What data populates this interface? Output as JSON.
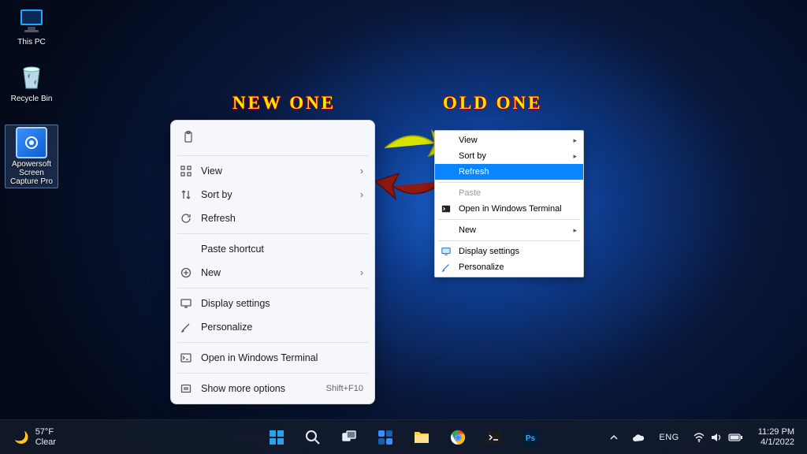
{
  "desktop_icons": {
    "this_pc": "This PC",
    "recycle_bin": "Recycle Bin",
    "apowersoft": "Apowersoft Screen Capture Pro"
  },
  "annotations": {
    "new_label": "NEW ONE",
    "old_label": "OLD ONE"
  },
  "menu_new": {
    "view": "View",
    "sort_by": "Sort by",
    "refresh": "Refresh",
    "paste_shortcut": "Paste shortcut",
    "new": "New",
    "display_settings": "Display settings",
    "personalize": "Personalize",
    "open_terminal": "Open in Windows Terminal",
    "show_more": "Show more options",
    "show_more_shortcut": "Shift+F10"
  },
  "menu_old": {
    "view": "View",
    "sort_by": "Sort by",
    "refresh": "Refresh",
    "paste": "Paste",
    "open_terminal": "Open in Windows Terminal",
    "new": "New",
    "display_settings": "Display settings",
    "personalize": "Personalize"
  },
  "taskbar": {
    "weather_temp": "57°F",
    "weather_cond": "Clear",
    "lang": "ENG",
    "time": "11:29 PM",
    "date": "4/1/2022"
  }
}
